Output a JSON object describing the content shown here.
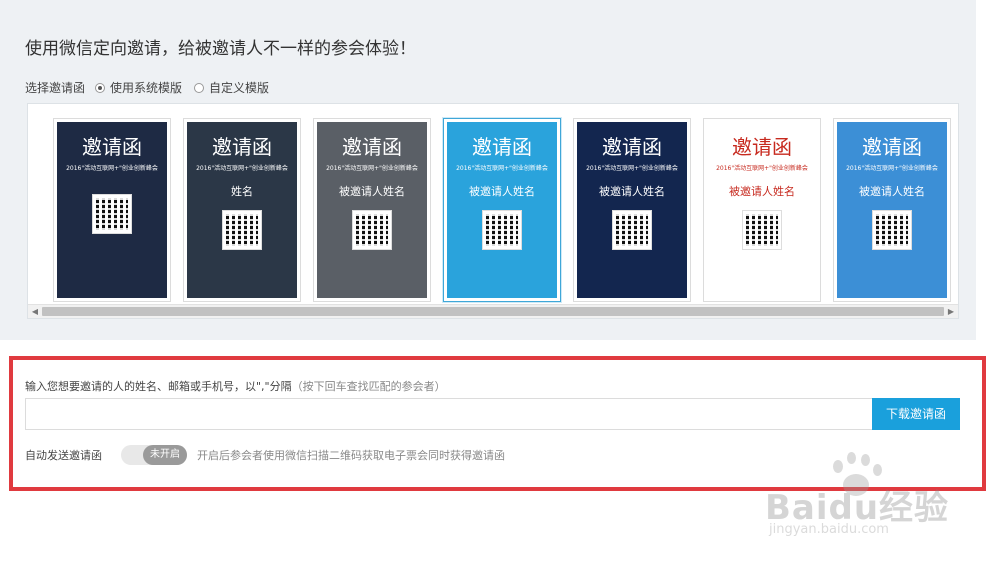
{
  "header": {
    "headline": "使用微信定向邀请，给被邀请人不一样的参会体验！"
  },
  "template_select": {
    "label": "选择邀请函",
    "options": [
      {
        "label": "使用系统模版",
        "selected": true
      },
      {
        "label": "自定义模版",
        "selected": false
      }
    ]
  },
  "templates": [
    {
      "title": "邀请函",
      "subtitle": "2016\"活动互联网+\"创业创新峰会",
      "name": "",
      "bg": "#1e2a44",
      "fg": "#ffffff",
      "selected": false
    },
    {
      "title": "邀请函",
      "subtitle": "2016\"活动互联网+\"创业创新峰会",
      "name": "姓名",
      "bg": "#2b3747",
      "fg": "#ffffff",
      "selected": false
    },
    {
      "title": "邀请函",
      "subtitle": "2016\"活动互联网+\"创业创新峰会",
      "name": "被邀请人姓名",
      "bg": "#5a5f66",
      "fg": "#ffffff",
      "selected": false
    },
    {
      "title": "邀请函",
      "subtitle": "2016\"活动互联网+\"创业创新峰会",
      "name": "被邀请人姓名",
      "bg": "#2aa3dc",
      "fg": "#ffffff",
      "selected": true
    },
    {
      "title": "邀请函",
      "subtitle": "2016\"活动互联网+\"创业创新峰会",
      "name": "被邀请人姓名",
      "bg": "#13264f",
      "fg": "#ffffff",
      "selected": false
    },
    {
      "title": "邀请函",
      "subtitle": "2016\"活动互联网+\"创业创新峰会",
      "name": "被邀请人姓名",
      "bg": "#ffffff",
      "fg": "#c72a1f",
      "selected": false
    },
    {
      "title": "邀请函",
      "subtitle": "2016\"活动互联网+\"创业创新峰会",
      "name": "被邀请人姓名",
      "bg": "#3c8fd6",
      "fg": "#ffffff",
      "selected": false
    }
  ],
  "invite": {
    "prompt": "输入您想要邀请的人的姓名、邮箱或手机号，以\",\"分隔",
    "hint": "（按下回车查找匹配的参会者）",
    "input_value": "",
    "download_button": "下载邀请函"
  },
  "auto_send": {
    "label": "自动发送邀请函",
    "toggle_label": "未开启",
    "enabled": false,
    "description": "开启后参会者使用微信扫描二维码获取电子票会同时获得邀请函"
  },
  "watermark": {
    "brand": "Baidu经验",
    "url": "jingyan.baidu.com"
  },
  "colors": {
    "accent": "#1aa0dc",
    "highlight_border": "#e03a3f",
    "panel_bg": "#eef1f4"
  }
}
